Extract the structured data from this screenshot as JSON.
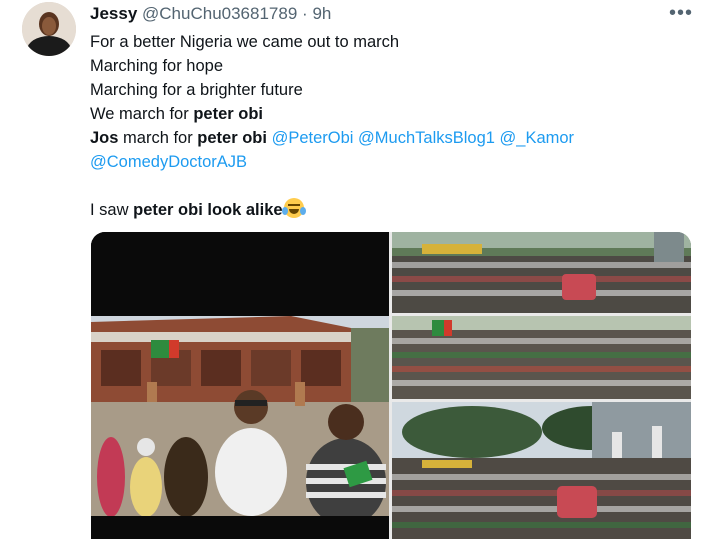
{
  "tweet": {
    "author_name": "Jessy",
    "author_handle": "@ChuChu03681789",
    "separator": "·",
    "time": "9h",
    "more_icon": "more-horizontal-icon",
    "lines": {
      "l1": "For a better Nigeria we came out to march",
      "l2": "Marching for hope",
      "l3": "Marching for a brighter future",
      "l4_prefix": "We march for ",
      "l4_bold": "peter obi",
      "l5_bold_a": "Jos",
      "l5_mid": " march for ",
      "l5_bold_b": "peter obi",
      "mention_1": "@PeterObi",
      "mention_2": "@MuchTalksBlog1",
      "mention_3": "@_Kamor",
      "mention_4": "@ComedyDoctorAJB",
      "l6_prefix": "I saw ",
      "l6_bold": "peter obi look alike",
      "emoji": "face-with-tears-of-joy-icon"
    }
  },
  "colors": {
    "text": "#0f1419",
    "secondary": "#536471",
    "mention": "#1d9bf0"
  }
}
